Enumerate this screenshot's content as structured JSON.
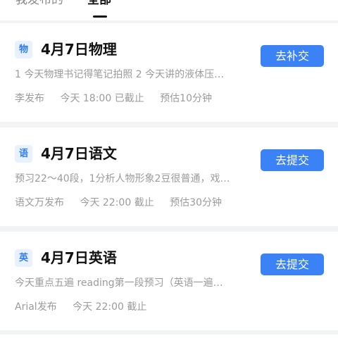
{
  "tabs": [
    {
      "label": "我发布的"
    },
    {
      "label": "全部"
    }
  ],
  "assignments": [
    {
      "subject_badge": "物",
      "title": "4月7日物理",
      "action_label": "去补交",
      "description": "1 今天物理书记得笔记拍照 2 今天讲的液体压…",
      "publisher": "李发布",
      "deadline": "今天 18:00 已截止",
      "estimate": "预估10分钟"
    },
    {
      "subject_badge": "语",
      "title": "4月7日语文",
      "action_label": "去提交",
      "description": "预习22～40段，1分析人物形象2豆很普通，戏…",
      "publisher": "语文万发布",
      "deadline": "今天 22:00 截止",
      "estimate": "预估30分钟"
    },
    {
      "subject_badge": "英",
      "title": "4月7日英语",
      "action_label": "去提交",
      "description": "今天重点五遍 reading第一段预习（英语一遍…",
      "publisher": "Arial发布",
      "deadline": "今天 22:00 截止"
    }
  ],
  "colors": {
    "accent": "#3b82f6",
    "badge_background": "#e8f1ff",
    "page_background": "#f2f3f5"
  }
}
